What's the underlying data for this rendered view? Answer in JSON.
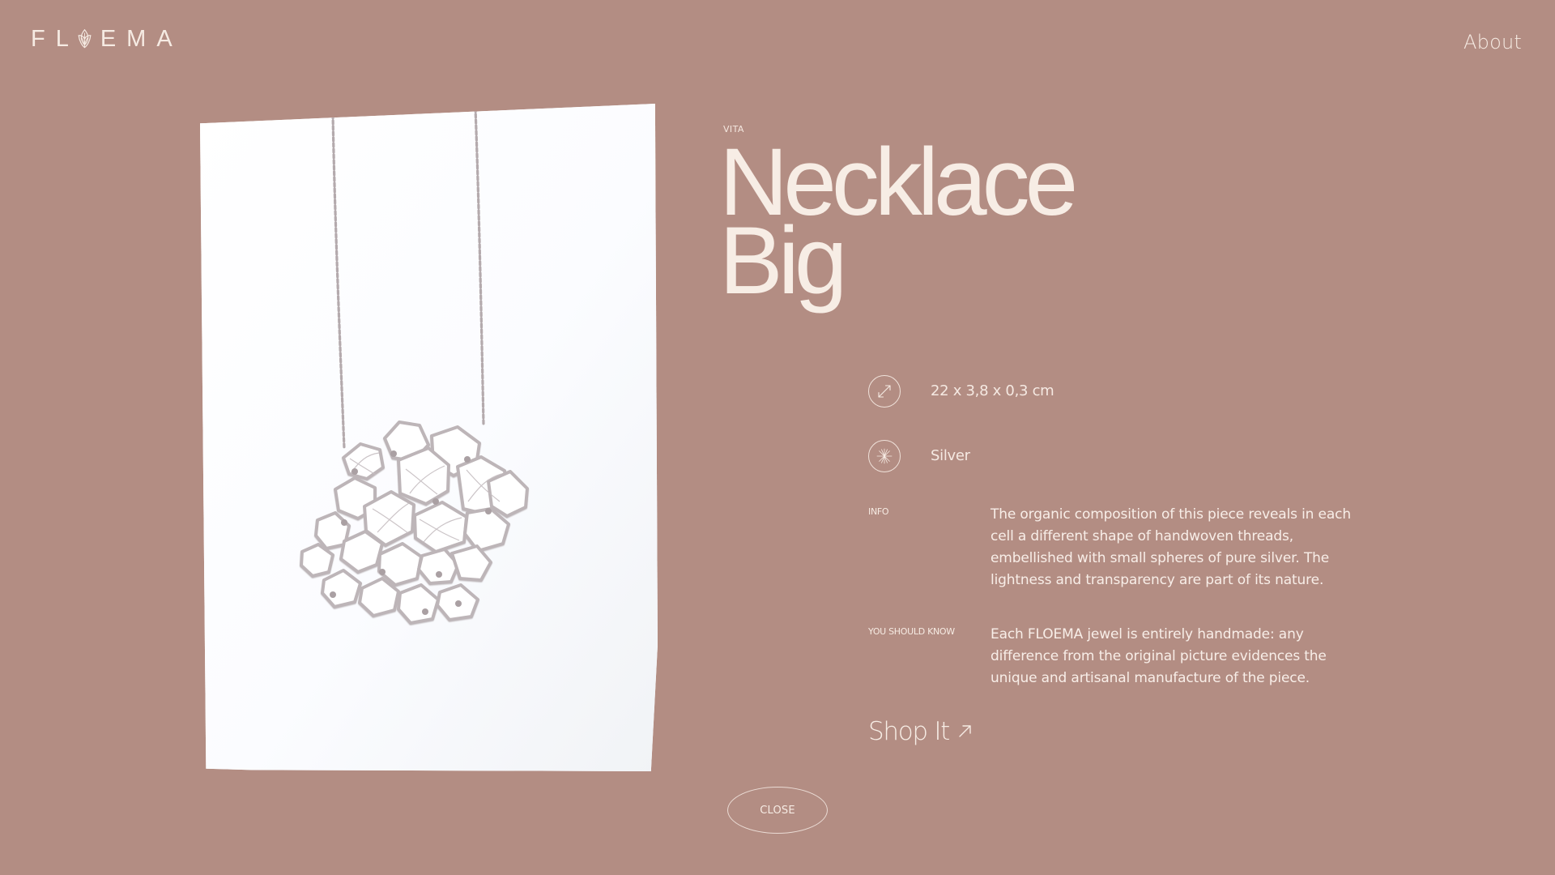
{
  "brand": {
    "logo_left": "FL",
    "logo_right": "EMA"
  },
  "nav": {
    "about_label": "About"
  },
  "product": {
    "collection": "VITA",
    "title_line_1": "Necklace",
    "title_line_2": "Big",
    "size_icon": "diagonal-arrow-icon",
    "size": "22 x 3,8 x 0,3 cm",
    "material_icon": "star-burst-icon",
    "material": "Silver",
    "info_label": "INFO",
    "info_text": "The organic composition of this piece reveals in each cell a different shape of handwoven threads, embellished with small spheres of pure silver. The lightness and transparency are part of its nature.",
    "know_label": "YOU SHOULD KNOW",
    "know_text": "Each FLOEMA jewel is entirely handmade: any difference from the original picture evidences the unique and artisanal manufacture of the piece.",
    "shop_label": "Shop It",
    "shop_icon": "arrow-up-right-icon"
  },
  "actions": {
    "close_label": "CLOSE"
  },
  "colors": {
    "background": "#b38d83",
    "text": "#f6ebe3",
    "photo_background": "#fdfeff",
    "silver": "#c8c2c5"
  }
}
